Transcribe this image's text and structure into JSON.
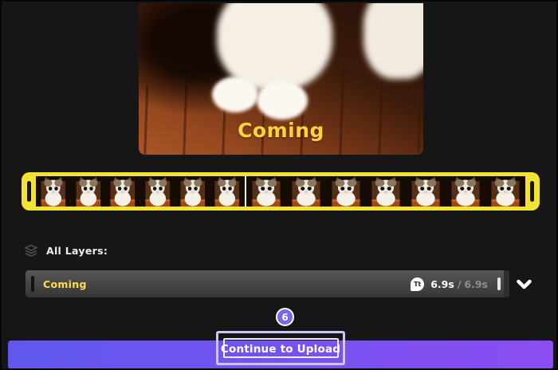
{
  "preview": {
    "caption": "Coming",
    "caption_color": "#ffd33c"
  },
  "filmstrip": {
    "border_color": "#f2e430",
    "segments": [
      6,
      7
    ],
    "playhead": true
  },
  "layers_panel": {
    "heading": "All Layers:",
    "layer": {
      "title": "Coming",
      "title_color": "#ffe04a",
      "type_badge": "Tt",
      "duration_current": "6.9s",
      "duration_separator": "/",
      "duration_total": "6.9s"
    }
  },
  "footer": {
    "button_label": "Continue to Upload",
    "gradient_left": "#5f58ee",
    "gradient_right": "#8b4df2"
  },
  "annotation": {
    "step_number": "6",
    "badge_fill": "#7668ec",
    "box_border": "#cdc7f3"
  }
}
